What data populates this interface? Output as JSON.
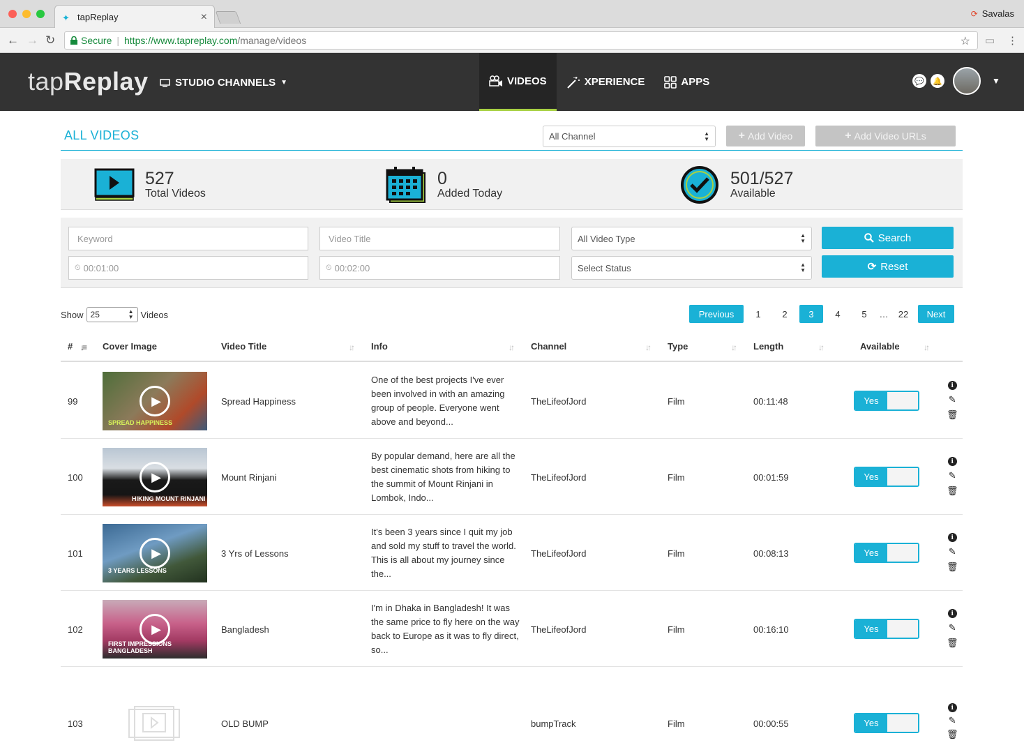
{
  "browser": {
    "tab_title": "tapReplay",
    "profile_name": "Savalas",
    "secure_label": "Secure",
    "url_host": "https://www.tapreplay.com",
    "url_path": "/manage/videos"
  },
  "header": {
    "logo_light": "tap",
    "logo_bold": "Replay",
    "studio_label": "STUDIO CHANNELS",
    "nav": [
      {
        "label": "VIDEOS",
        "active": true
      },
      {
        "label": "XPERIENCE",
        "active": false
      },
      {
        "label": "APPS",
        "active": false
      }
    ]
  },
  "page": {
    "title": "ALL VIDEOS",
    "channel_select": "All Channel",
    "add_video": "Add Video",
    "add_video_urls": "Add Video URLs"
  },
  "stats": [
    {
      "value": "527",
      "label": "Total Videos"
    },
    {
      "value": "0",
      "label": "Added Today"
    },
    {
      "value": "501/527",
      "label": "Available"
    }
  ],
  "filters": {
    "keyword_placeholder": "Keyword",
    "title_placeholder": "Video Title",
    "type_select": "All Video Type",
    "status_select": "Select Status",
    "min_length": "00:01:00",
    "max_length": "00:02:00",
    "search_label": "Search",
    "reset_label": "Reset"
  },
  "listing": {
    "show_label": "Show",
    "page_size": "25",
    "videos_label": "Videos",
    "prev_label": "Previous",
    "next_label": "Next",
    "pages": [
      "1",
      "2",
      "3",
      "4",
      "5",
      "…",
      "22"
    ],
    "current_page": "3"
  },
  "table": {
    "headers": {
      "num": "#",
      "cover": "Cover Image",
      "title": "Video Title",
      "info": "Info",
      "channel": "Channel",
      "type": "Type",
      "length": "Length",
      "available": "Available"
    },
    "toggle_on_label": "Yes",
    "rows": [
      {
        "num": "99",
        "caption": "Spread Happiness",
        "title": "Spread Happiness",
        "info": "One of the best projects I've ever been involved in with an amazing group of people. Everyone went above and beyond...",
        "channel": "TheLifeofJord",
        "type": "Film",
        "length": "00:11:48"
      },
      {
        "num": "100",
        "caption": "Hiking Mount Rinjani",
        "title": "Mount Rinjani",
        "info": "By popular demand, here are all the best cinematic shots from hiking to the summit of Mount Rinjani in Lombok, Indo...",
        "channel": "TheLifeofJord",
        "type": "Film",
        "length": "00:01:59"
      },
      {
        "num": "101",
        "caption": "3 Years Lessons",
        "title": "3 Yrs of Lessons",
        "info": "It's been 3 years since I quit my job and sold my stuff to travel the world. This is all about my journey since the...",
        "channel": "TheLifeofJord",
        "type": "Film",
        "length": "00:08:13"
      },
      {
        "num": "102",
        "caption": "First Impressions Bangladesh",
        "title": "Bangladesh",
        "info": "I'm in Dhaka in Bangladesh! It was the same price to fly here on the way back to Europe as it was to fly direct, so...",
        "channel": "TheLifeofJord",
        "type": "Film",
        "length": "00:16:10"
      },
      {
        "num": "103",
        "caption": "",
        "title": "OLD BUMP",
        "info": "",
        "channel": "bumpTrack",
        "type": "Film",
        "length": "00:00:55"
      }
    ]
  },
  "colors": {
    "accent": "#1ab1d6",
    "header_bg": "#333333",
    "nav_active_border": "#a7d143",
    "disabled_button": "#c4c4c4"
  }
}
